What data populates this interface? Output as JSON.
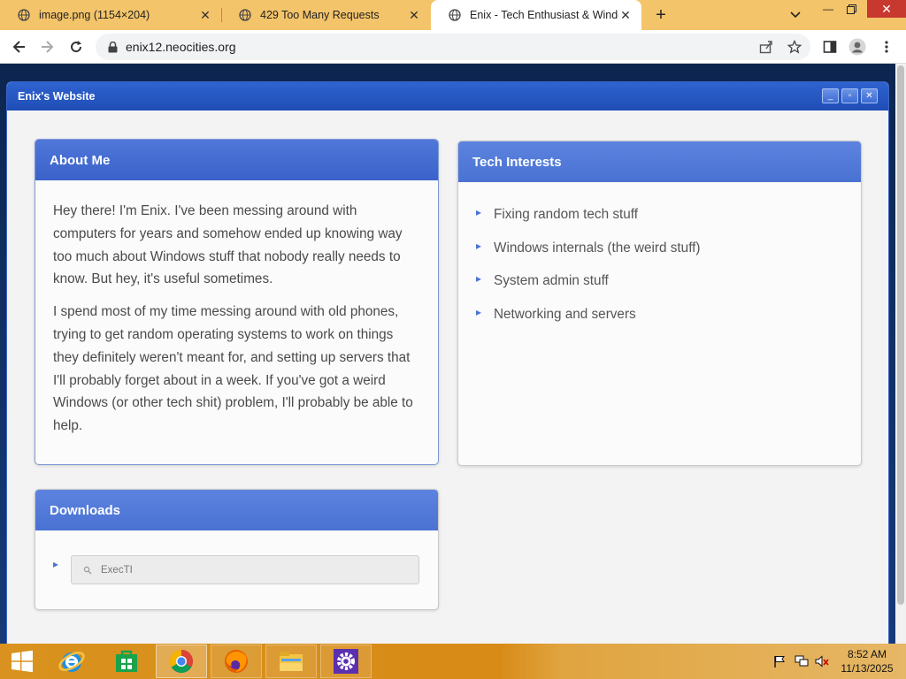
{
  "browser": {
    "tabs": [
      {
        "title": "image.png (1154×204)",
        "active": false
      },
      {
        "title": "429 Too Many Requests",
        "active": false
      },
      {
        "title": "Enix - Tech Enthusiast & Windows",
        "active": true
      }
    ],
    "url": "enix12.neocities.org",
    "accent_color": "#f4c46a"
  },
  "window": {
    "title": "Enix's Website",
    "titlebar_color": "#2f63d0"
  },
  "about": {
    "heading": "About Me",
    "paragraphs": [
      "Hey there! I'm Enix. I've been messing around with computers for years and somehow ended up knowing way too much about Windows stuff that nobody really needs to know. But hey, it's useful sometimes.",
      "I spend most of my time messing around with old phones, trying to get random operating systems to work on things they definitely weren't meant for, and setting up servers that I'll probably forget about in a week. If you've got a weird Windows (or other tech shit) problem, I'll probably be able to help."
    ]
  },
  "tech": {
    "heading": "Tech Interests",
    "items": [
      "Fixing random tech stuff",
      "Windows internals (the weird stuff)",
      "System admin stuff",
      "Networking and servers"
    ]
  },
  "downloads": {
    "heading": "Downloads",
    "items": [
      {
        "name": "ExecTI",
        "icon": "download-icon"
      }
    ]
  },
  "taskbar": {
    "apps": [
      "start-icon",
      "internet-explorer-icon",
      "store-icon",
      "chrome-icon",
      "firefox-icon",
      "file-explorer-icon",
      "settings-icon"
    ],
    "time": "8:52 AM",
    "date": "11/13/2025"
  }
}
